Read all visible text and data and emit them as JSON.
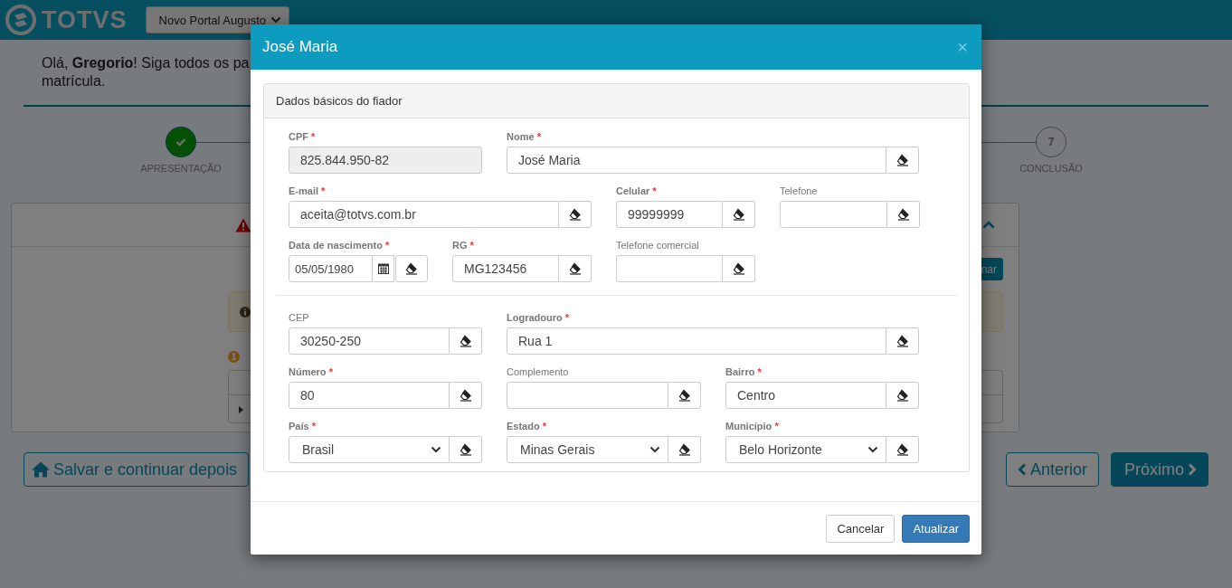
{
  "header": {
    "logo": "TOTVS",
    "portal_select": "Novo Portal Augusto"
  },
  "greeting": {
    "lines": [
      "Olá, **Gregorio**! Siga todos os pa",
      "matrícula."
    ]
  },
  "stepper": [
    {
      "label": "APRESENTAÇÃO",
      "done": true
    },
    {
      "number": "7",
      "label": "CONCLUSÃO",
      "done": false
    }
  ],
  "panel": {
    "action_button": "nar",
    "badge": "1"
  },
  "footer_buttons": {
    "save": "Salvar e continuar depois",
    "previous": "Anterior",
    "next": "Próximo"
  },
  "modal": {
    "title": "José Maria",
    "close": "×",
    "section_title": "Dados básicos do fiador",
    "groups": [
      [
        [
          {
            "label": "CPF",
            "required": true,
            "mark": "*",
            "kind": "readonly",
            "value": "825.844.950-82"
          },
          {
            "label": "Nome",
            "required": true,
            "mark": "*",
            "kind": "text",
            "value": "José Maria"
          }
        ],
        [
          {
            "label": "E-mail",
            "required": true,
            "mark": "*",
            "kind": "text",
            "value": "aceita@totvs.com.br"
          },
          {
            "label": "Celular",
            "required": true,
            "mark": "*",
            "kind": "text",
            "value": "99999999"
          },
          {
            "label": "Telefone",
            "required": false,
            "kind": "text"
          }
        ],
        [
          {
            "label": "Data de nascimento",
            "required": true,
            "mark": "*",
            "kind": "date",
            "value": "05/05/1980"
          },
          {
            "label": "RG",
            "required": true,
            "mark": "*",
            "kind": "text",
            "value": "MG123456"
          },
          {
            "label": "Telefone comercial",
            "required": false,
            "kind": "text"
          }
        ]
      ],
      [
        [
          {
            "label": "CEP",
            "required": false,
            "kind": "text",
            "value": "30250-250"
          },
          {
            "label": "Logradouro",
            "required": true,
            "mark": "*",
            "kind": "text",
            "value": "Rua 1"
          }
        ],
        [
          {
            "label": "Número",
            "required": true,
            "mark": "*",
            "kind": "text",
            "value": "80"
          },
          {
            "label": "Complemento",
            "required": false,
            "kind": "text"
          },
          {
            "label": "Bairro",
            "required": true,
            "mark": "*",
            "kind": "text",
            "value": "Centro"
          }
        ],
        [
          {
            "label": "País",
            "required": true,
            "mark": "*",
            "kind": "select",
            "value": "Brasil"
          },
          {
            "label": "Estado",
            "required": true,
            "mark": "*",
            "kind": "select",
            "value": "Minas Gerais"
          },
          {
            "label": "Município",
            "required": true,
            "mark": "*",
            "kind": "select",
            "value": "Belo Horizonte"
          }
        ]
      ]
    ],
    "buttons": [
      {
        "label": "Cancelar",
        "kind": "default"
      },
      {
        "label": "Atualizar",
        "kind": "primary"
      }
    ]
  }
}
